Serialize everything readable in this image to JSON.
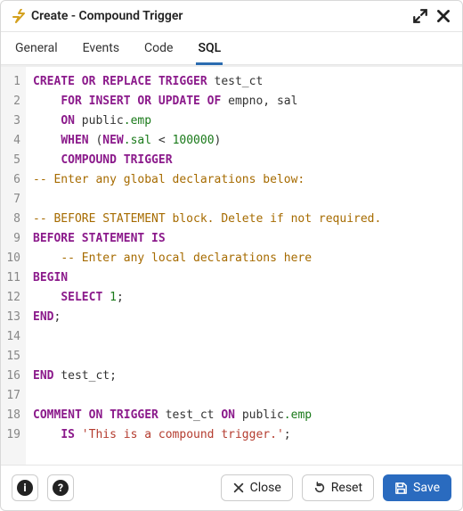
{
  "titlebar": {
    "title": "Create - Compound Trigger"
  },
  "tabs": [
    {
      "label": "General",
      "active": false
    },
    {
      "label": "Events",
      "active": false
    },
    {
      "label": "Code",
      "active": false
    },
    {
      "label": "SQL",
      "active": true
    }
  ],
  "code": {
    "line_count": 19,
    "lines": [
      [
        [
          "kw",
          "CREATE OR REPLACE TRIGGER"
        ],
        [
          "id",
          " test_ct"
        ]
      ],
      [
        [
          "id",
          "    "
        ],
        [
          "kw",
          "FOR INSERT OR UPDATE OF"
        ],
        [
          "id",
          " empno, sal"
        ]
      ],
      [
        [
          "id",
          "    "
        ],
        [
          "kw",
          "ON"
        ],
        [
          "id",
          " public"
        ],
        [
          "dot",
          ".emp"
        ]
      ],
      [
        [
          "id",
          "    "
        ],
        [
          "kw",
          "WHEN"
        ],
        [
          "id",
          " ("
        ],
        [
          "kw",
          "NEW"
        ],
        [
          "dot",
          ".sal"
        ],
        [
          "id",
          " < "
        ],
        [
          "num",
          "100000"
        ],
        [
          "id",
          ")"
        ]
      ],
      [
        [
          "id",
          "    "
        ],
        [
          "kw",
          "COMPOUND TRIGGER"
        ]
      ],
      [
        [
          "cm",
          "-- Enter any global declarations below:"
        ]
      ],
      [
        [
          "id",
          ""
        ]
      ],
      [
        [
          "cm",
          "-- BEFORE STATEMENT block. Delete if not required."
        ]
      ],
      [
        [
          "kw",
          "BEFORE STATEMENT IS"
        ]
      ],
      [
        [
          "id",
          "    "
        ],
        [
          "cm",
          "-- Enter any local declarations here"
        ]
      ],
      [
        [
          "kw",
          "BEGIN"
        ]
      ],
      [
        [
          "id",
          "    "
        ],
        [
          "kw",
          "SELECT"
        ],
        [
          "id",
          " "
        ],
        [
          "num",
          "1"
        ],
        [
          "id",
          ";"
        ]
      ],
      [
        [
          "kw",
          "END"
        ],
        [
          "id",
          ";"
        ]
      ],
      [
        [
          "id",
          ""
        ]
      ],
      [
        [
          "id",
          ""
        ]
      ],
      [
        [
          "kw",
          "END"
        ],
        [
          "id",
          " test_ct;"
        ]
      ],
      [
        [
          "id",
          ""
        ]
      ],
      [
        [
          "kw",
          "COMMENT ON TRIGGER"
        ],
        [
          "id",
          " test_ct "
        ],
        [
          "kw",
          "ON"
        ],
        [
          "id",
          " public"
        ],
        [
          "dot",
          ".emp"
        ]
      ],
      [
        [
          "id",
          "    "
        ],
        [
          "kw",
          "IS"
        ],
        [
          "id",
          " "
        ],
        [
          "str",
          "'This is a compound trigger.'"
        ],
        [
          "id",
          ";"
        ]
      ]
    ]
  },
  "footer": {
    "close": "Close",
    "reset": "Reset",
    "save": "Save"
  }
}
